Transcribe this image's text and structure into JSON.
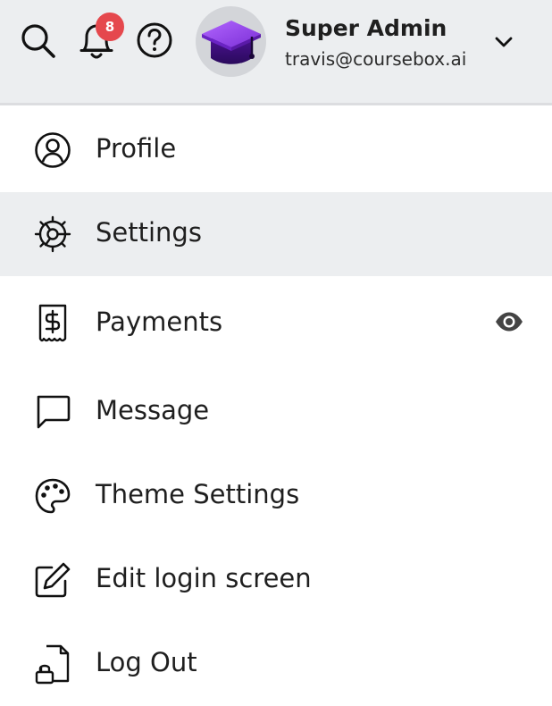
{
  "header": {
    "search_icon": "search-icon",
    "notifications_icon": "bell-icon",
    "notification_count": "8",
    "help_icon": "help-icon",
    "avatar_icon": "graduation-cap-icon",
    "user_name": "Super Admin",
    "user_email": "travis@coursebox.ai",
    "dropdown_icon": "chevron-down-icon",
    "badge_color": "#e5484d",
    "avatar_accent": "#7b2fd6"
  },
  "menu": {
    "items": [
      {
        "label": "Profile",
        "icon": "user-circle-icon",
        "active": false
      },
      {
        "label": "Settings",
        "icon": "gear-icon",
        "active": true
      },
      {
        "label": "Payments",
        "icon": "receipt-dollar-icon",
        "active": false,
        "trailing_icon": "eye-icon"
      },
      {
        "label": "Message",
        "icon": "message-icon",
        "active": false
      },
      {
        "label": "Theme Settings",
        "icon": "palette-icon",
        "active": false
      },
      {
        "label": "Edit login screen",
        "icon": "edit-icon",
        "active": false
      },
      {
        "label": "Log Out",
        "icon": "lock-file-icon",
        "active": false
      }
    ]
  }
}
